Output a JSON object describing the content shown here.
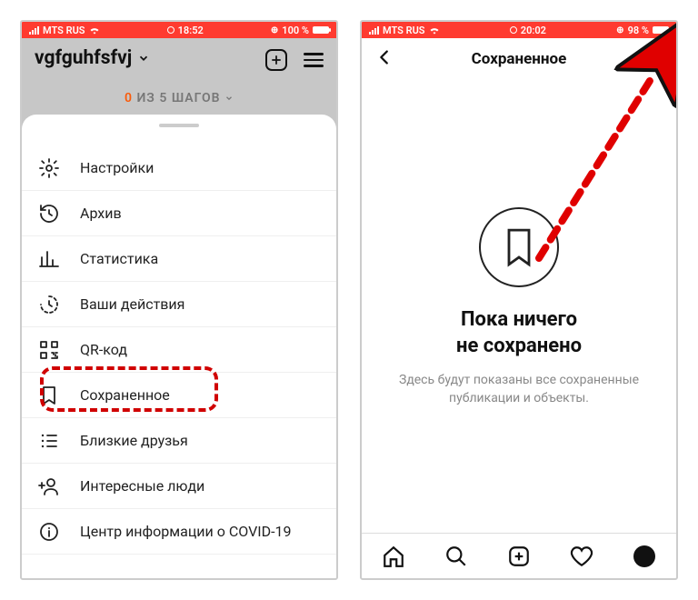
{
  "left": {
    "status": {
      "carrier": "MTS RUS",
      "wifi_icon": "wifi",
      "time": "18:52",
      "battery_pct": "100 %"
    },
    "username": "vgfguhfsfvj",
    "steps_done": "0",
    "steps_total": "5",
    "steps_label": "ШАГОВ",
    "steps_text": "ИЗ",
    "menu": [
      {
        "icon": "gear-icon",
        "label": "Настройки"
      },
      {
        "icon": "history-icon",
        "label": "Архив"
      },
      {
        "icon": "chart-icon",
        "label": "Статистика"
      },
      {
        "icon": "clock-icon",
        "label": "Ваши действия"
      },
      {
        "icon": "qr-icon",
        "label": "QR-код"
      },
      {
        "icon": "bookmark-icon",
        "label": "Сохраненное"
      },
      {
        "icon": "list-icon",
        "label": "Близкие друзья"
      },
      {
        "icon": "add-user-icon",
        "label": "Интересные люди"
      },
      {
        "icon": "info-icon",
        "label": "Центр информации о COVID-19"
      }
    ],
    "highlight_index": 5
  },
  "right": {
    "status": {
      "carrier": "MTS RUS",
      "wifi_icon": "wifi",
      "time": "20:02",
      "battery_pct": "98 %"
    },
    "nav_title": "Сохраненное",
    "empty_title_line1": "Пока ничего",
    "empty_title_line2": "не сохранено",
    "empty_sub": "Здесь будут показаны все сохраненные публикации и объекты."
  },
  "annotations": {
    "highlight_color": "#d00000",
    "arrow_color": "#e00000"
  }
}
